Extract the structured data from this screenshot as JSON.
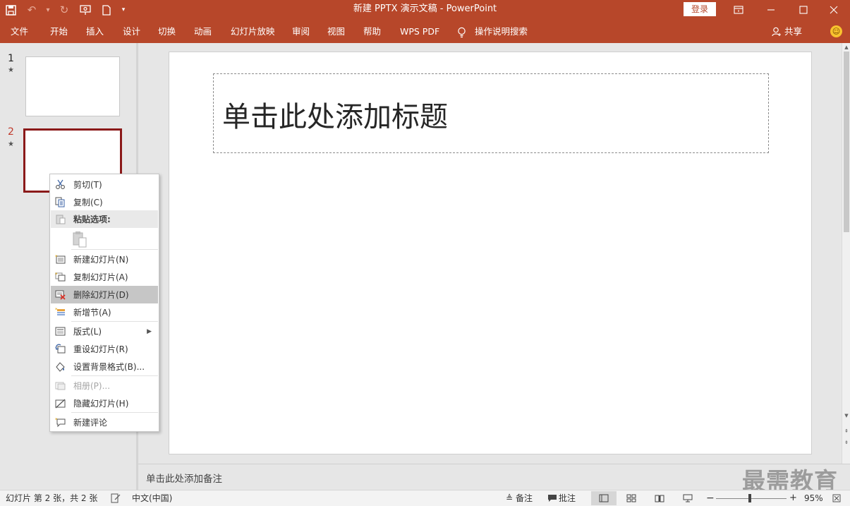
{
  "app": {
    "window_title": "新建 PPTX 演示文稿  -  PowerPoint",
    "login_label": "登录"
  },
  "ribbon": {
    "tabs": [
      "文件",
      "开始",
      "插入",
      "设计",
      "切换",
      "动画",
      "幻灯片放映",
      "审阅",
      "视图",
      "帮助",
      "WPS PDF",
      "操作说明搜索"
    ],
    "share_label": "共享"
  },
  "slides": [
    {
      "number": "1",
      "selected": false
    },
    {
      "number": "2",
      "selected": true
    }
  ],
  "slide": {
    "title_placeholder": "单击此处添加标题"
  },
  "notes": {
    "placeholder": "单击此处添加备注"
  },
  "context_menu": {
    "items": [
      {
        "label": "剪切(T)",
        "icon": "scissors-icon",
        "state": "normal"
      },
      {
        "label": "复制(C)",
        "icon": "copy-icon",
        "state": "normal"
      },
      {
        "label": "粘贴选项:",
        "icon": "paste-icon",
        "state": "header"
      },
      {
        "label": "新建幻灯片(N)",
        "icon": "new-slide-icon",
        "state": "normal"
      },
      {
        "label": "复制幻灯片(A)",
        "icon": "duplicate-slide-icon",
        "state": "normal"
      },
      {
        "label": "删除幻灯片(D)",
        "icon": "delete-slide-icon",
        "state": "highlighted"
      },
      {
        "label": "新增节(A)",
        "icon": "add-section-icon",
        "state": "normal"
      },
      {
        "label": "版式(L)",
        "icon": "layout-icon",
        "state": "submenu"
      },
      {
        "label": "重设幻灯片(R)",
        "icon": "reset-slide-icon",
        "state": "normal"
      },
      {
        "label": "设置背景格式(B)...",
        "icon": "format-background-icon",
        "state": "normal"
      },
      {
        "label": "相册(P)...",
        "icon": "photo-album-icon",
        "state": "disabled"
      },
      {
        "label": "隐藏幻灯片(H)",
        "icon": "hide-slide-icon",
        "state": "normal"
      },
      {
        "label": "新建评论",
        "icon": "new-comment-icon",
        "state": "normal"
      }
    ]
  },
  "statusbar": {
    "slide_info": "幻灯片 第 2 张，共 2 张",
    "language": "中文(中国)",
    "notes_label": "备注",
    "comments_label": "批注",
    "zoom_percent": "95%",
    "zoom_level": 0.47
  },
  "watermark": "最需教育",
  "colors": {
    "brand": "#b7472a",
    "selected_thumb_border": "#8b1a1a",
    "menu_highlight": "#c6c6c6"
  }
}
